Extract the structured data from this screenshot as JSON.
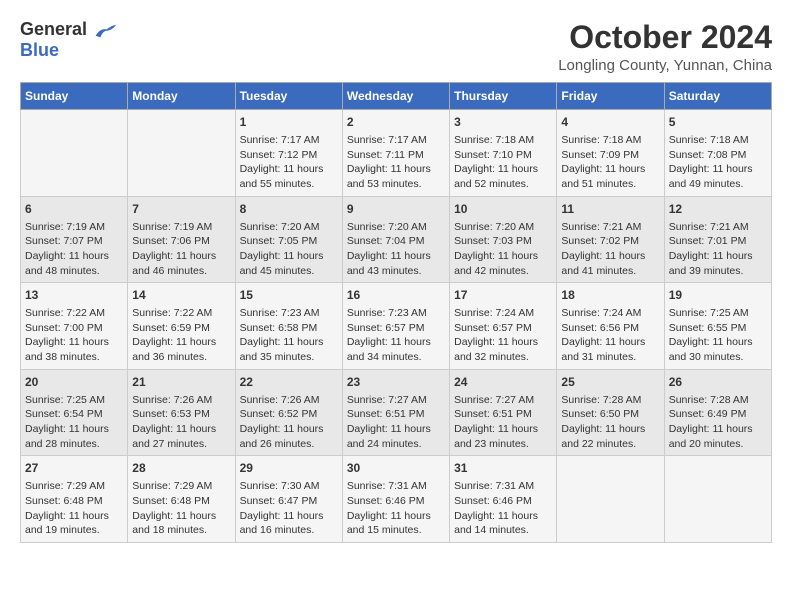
{
  "header": {
    "logo_general": "General",
    "logo_blue": "Blue",
    "title": "October 2024",
    "subtitle": "Longling County, Yunnan, China"
  },
  "days_of_week": [
    "Sunday",
    "Monday",
    "Tuesday",
    "Wednesday",
    "Thursday",
    "Friday",
    "Saturday"
  ],
  "weeks": [
    [
      {
        "day": "",
        "content": ""
      },
      {
        "day": "",
        "content": ""
      },
      {
        "day": "1",
        "sunrise": "7:17 AM",
        "sunset": "7:12 PM",
        "daylight": "11 hours and 55 minutes."
      },
      {
        "day": "2",
        "sunrise": "7:17 AM",
        "sunset": "7:11 PM",
        "daylight": "11 hours and 53 minutes."
      },
      {
        "day": "3",
        "sunrise": "7:18 AM",
        "sunset": "7:10 PM",
        "daylight": "11 hours and 52 minutes."
      },
      {
        "day": "4",
        "sunrise": "7:18 AM",
        "sunset": "7:09 PM",
        "daylight": "11 hours and 51 minutes."
      },
      {
        "day": "5",
        "sunrise": "7:18 AM",
        "sunset": "7:08 PM",
        "daylight": "11 hours and 49 minutes."
      }
    ],
    [
      {
        "day": "6",
        "sunrise": "7:19 AM",
        "sunset": "7:07 PM",
        "daylight": "11 hours and 48 minutes."
      },
      {
        "day": "7",
        "sunrise": "7:19 AM",
        "sunset": "7:06 PM",
        "daylight": "11 hours and 46 minutes."
      },
      {
        "day": "8",
        "sunrise": "7:20 AM",
        "sunset": "7:05 PM",
        "daylight": "11 hours and 45 minutes."
      },
      {
        "day": "9",
        "sunrise": "7:20 AM",
        "sunset": "7:04 PM",
        "daylight": "11 hours and 43 minutes."
      },
      {
        "day": "10",
        "sunrise": "7:20 AM",
        "sunset": "7:03 PM",
        "daylight": "11 hours and 42 minutes."
      },
      {
        "day": "11",
        "sunrise": "7:21 AM",
        "sunset": "7:02 PM",
        "daylight": "11 hours and 41 minutes."
      },
      {
        "day": "12",
        "sunrise": "7:21 AM",
        "sunset": "7:01 PM",
        "daylight": "11 hours and 39 minutes."
      }
    ],
    [
      {
        "day": "13",
        "sunrise": "7:22 AM",
        "sunset": "7:00 PM",
        "daylight": "11 hours and 38 minutes."
      },
      {
        "day": "14",
        "sunrise": "7:22 AM",
        "sunset": "6:59 PM",
        "daylight": "11 hours and 36 minutes."
      },
      {
        "day": "15",
        "sunrise": "7:23 AM",
        "sunset": "6:58 PM",
        "daylight": "11 hours and 35 minutes."
      },
      {
        "day": "16",
        "sunrise": "7:23 AM",
        "sunset": "6:57 PM",
        "daylight": "11 hours and 34 minutes."
      },
      {
        "day": "17",
        "sunrise": "7:24 AM",
        "sunset": "6:57 PM",
        "daylight": "11 hours and 32 minutes."
      },
      {
        "day": "18",
        "sunrise": "7:24 AM",
        "sunset": "6:56 PM",
        "daylight": "11 hours and 31 minutes."
      },
      {
        "day": "19",
        "sunrise": "7:25 AM",
        "sunset": "6:55 PM",
        "daylight": "11 hours and 30 minutes."
      }
    ],
    [
      {
        "day": "20",
        "sunrise": "7:25 AM",
        "sunset": "6:54 PM",
        "daylight": "11 hours and 28 minutes."
      },
      {
        "day": "21",
        "sunrise": "7:26 AM",
        "sunset": "6:53 PM",
        "daylight": "11 hours and 27 minutes."
      },
      {
        "day": "22",
        "sunrise": "7:26 AM",
        "sunset": "6:52 PM",
        "daylight": "11 hours and 26 minutes."
      },
      {
        "day": "23",
        "sunrise": "7:27 AM",
        "sunset": "6:51 PM",
        "daylight": "11 hours and 24 minutes."
      },
      {
        "day": "24",
        "sunrise": "7:27 AM",
        "sunset": "6:51 PM",
        "daylight": "11 hours and 23 minutes."
      },
      {
        "day": "25",
        "sunrise": "7:28 AM",
        "sunset": "6:50 PM",
        "daylight": "11 hours and 22 minutes."
      },
      {
        "day": "26",
        "sunrise": "7:28 AM",
        "sunset": "6:49 PM",
        "daylight": "11 hours and 20 minutes."
      }
    ],
    [
      {
        "day": "27",
        "sunrise": "7:29 AM",
        "sunset": "6:48 PM",
        "daylight": "11 hours and 19 minutes."
      },
      {
        "day": "28",
        "sunrise": "7:29 AM",
        "sunset": "6:48 PM",
        "daylight": "11 hours and 18 minutes."
      },
      {
        "day": "29",
        "sunrise": "7:30 AM",
        "sunset": "6:47 PM",
        "daylight": "11 hours and 16 minutes."
      },
      {
        "day": "30",
        "sunrise": "7:31 AM",
        "sunset": "6:46 PM",
        "daylight": "11 hours and 15 minutes."
      },
      {
        "day": "31",
        "sunrise": "7:31 AM",
        "sunset": "6:46 PM",
        "daylight": "11 hours and 14 minutes."
      },
      {
        "day": "",
        "content": ""
      },
      {
        "day": "",
        "content": ""
      }
    ]
  ],
  "labels": {
    "sunrise_prefix": "Sunrise: ",
    "sunset_prefix": "Sunset: ",
    "daylight_prefix": "Daylight: "
  }
}
